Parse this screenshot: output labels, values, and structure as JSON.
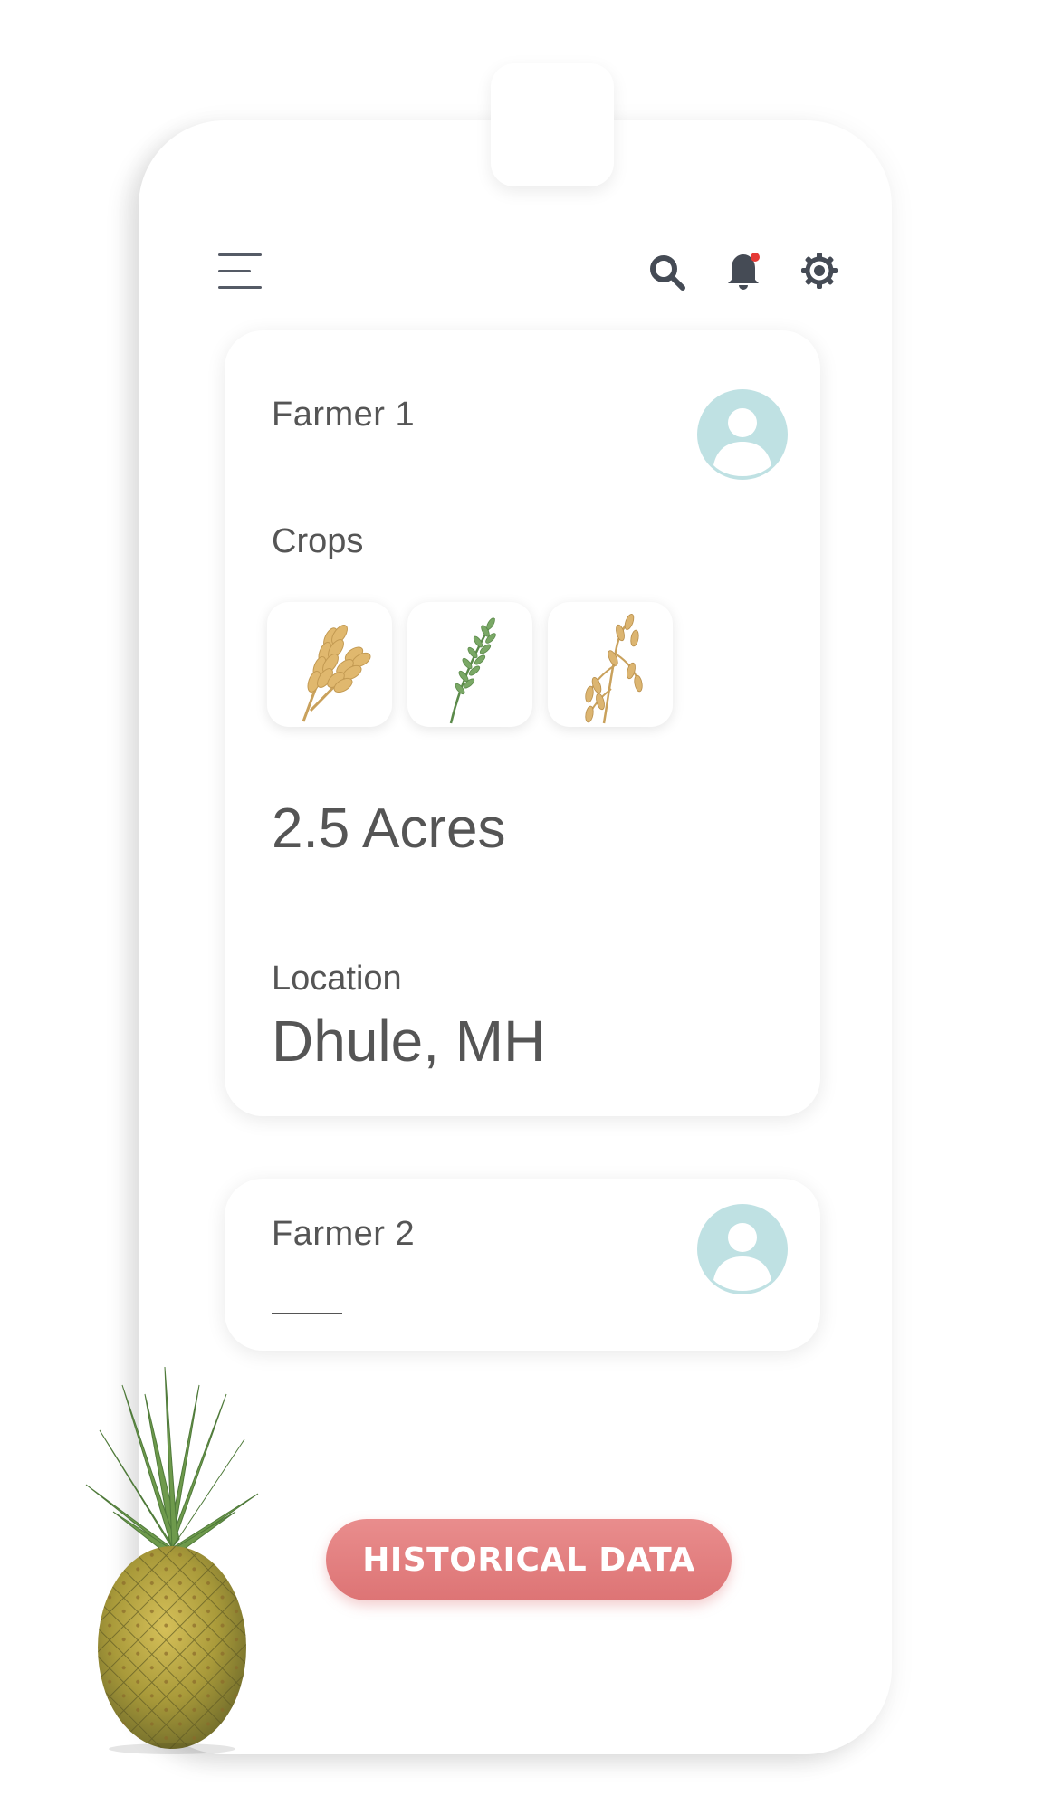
{
  "header": {
    "menu_icon": "hamburger-menu-icon",
    "search_icon": "search-icon",
    "notification_icon": "bell-icon",
    "notification_badge_color": "#e53935",
    "settings_icon": "gear-icon"
  },
  "farmers": [
    {
      "name": "Farmer 1",
      "avatar_icon": "user-avatar-icon",
      "crops_label": "Crops",
      "crops": [
        "wheat",
        "rice",
        "oats"
      ],
      "area": "2.5 Acres",
      "location_label": "Location",
      "location": "Dhule, MH"
    },
    {
      "name": "Farmer 2",
      "avatar_icon": "user-avatar-icon"
    }
  ],
  "actions": {
    "historical_data_label": "HISTORICAL DATA"
  },
  "colors": {
    "accent": "#dd7475",
    "avatar_bg": "#bfe1e3",
    "text": "#555555",
    "icon": "#555b66"
  }
}
